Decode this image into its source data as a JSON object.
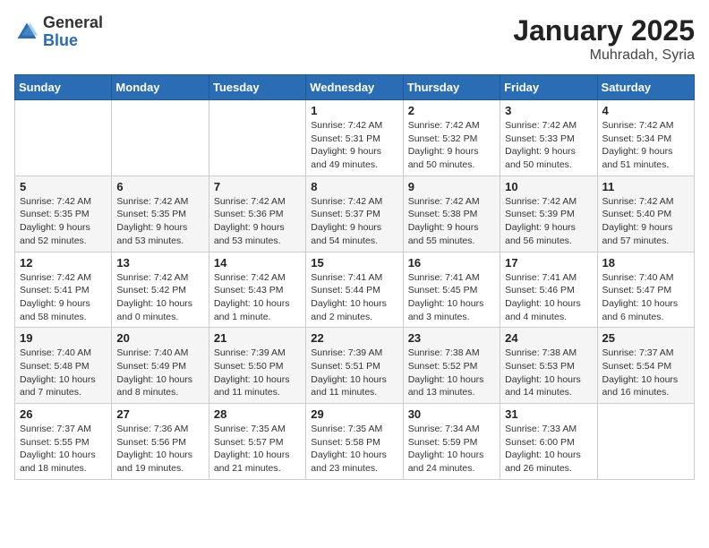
{
  "logo": {
    "general": "General",
    "blue": "Blue"
  },
  "header": {
    "month_year": "January 2025",
    "location": "Muhradah, Syria"
  },
  "weekdays": [
    "Sunday",
    "Monday",
    "Tuesday",
    "Wednesday",
    "Thursday",
    "Friday",
    "Saturday"
  ],
  "weeks": [
    [
      {
        "num": "",
        "info": ""
      },
      {
        "num": "",
        "info": ""
      },
      {
        "num": "",
        "info": ""
      },
      {
        "num": "1",
        "info": "Sunrise: 7:42 AM\nSunset: 5:31 PM\nDaylight: 9 hours\nand 49 minutes."
      },
      {
        "num": "2",
        "info": "Sunrise: 7:42 AM\nSunset: 5:32 PM\nDaylight: 9 hours\nand 50 minutes."
      },
      {
        "num": "3",
        "info": "Sunrise: 7:42 AM\nSunset: 5:33 PM\nDaylight: 9 hours\nand 50 minutes."
      },
      {
        "num": "4",
        "info": "Sunrise: 7:42 AM\nSunset: 5:34 PM\nDaylight: 9 hours\nand 51 minutes."
      }
    ],
    [
      {
        "num": "5",
        "info": "Sunrise: 7:42 AM\nSunset: 5:35 PM\nDaylight: 9 hours\nand 52 minutes."
      },
      {
        "num": "6",
        "info": "Sunrise: 7:42 AM\nSunset: 5:35 PM\nDaylight: 9 hours\nand 53 minutes."
      },
      {
        "num": "7",
        "info": "Sunrise: 7:42 AM\nSunset: 5:36 PM\nDaylight: 9 hours\nand 53 minutes."
      },
      {
        "num": "8",
        "info": "Sunrise: 7:42 AM\nSunset: 5:37 PM\nDaylight: 9 hours\nand 54 minutes."
      },
      {
        "num": "9",
        "info": "Sunrise: 7:42 AM\nSunset: 5:38 PM\nDaylight: 9 hours\nand 55 minutes."
      },
      {
        "num": "10",
        "info": "Sunrise: 7:42 AM\nSunset: 5:39 PM\nDaylight: 9 hours\nand 56 minutes."
      },
      {
        "num": "11",
        "info": "Sunrise: 7:42 AM\nSunset: 5:40 PM\nDaylight: 9 hours\nand 57 minutes."
      }
    ],
    [
      {
        "num": "12",
        "info": "Sunrise: 7:42 AM\nSunset: 5:41 PM\nDaylight: 9 hours\nand 58 minutes."
      },
      {
        "num": "13",
        "info": "Sunrise: 7:42 AM\nSunset: 5:42 PM\nDaylight: 10 hours\nand 0 minutes."
      },
      {
        "num": "14",
        "info": "Sunrise: 7:42 AM\nSunset: 5:43 PM\nDaylight: 10 hours\nand 1 minute."
      },
      {
        "num": "15",
        "info": "Sunrise: 7:41 AM\nSunset: 5:44 PM\nDaylight: 10 hours\nand 2 minutes."
      },
      {
        "num": "16",
        "info": "Sunrise: 7:41 AM\nSunset: 5:45 PM\nDaylight: 10 hours\nand 3 minutes."
      },
      {
        "num": "17",
        "info": "Sunrise: 7:41 AM\nSunset: 5:46 PM\nDaylight: 10 hours\nand 4 minutes."
      },
      {
        "num": "18",
        "info": "Sunrise: 7:40 AM\nSunset: 5:47 PM\nDaylight: 10 hours\nand 6 minutes."
      }
    ],
    [
      {
        "num": "19",
        "info": "Sunrise: 7:40 AM\nSunset: 5:48 PM\nDaylight: 10 hours\nand 7 minutes."
      },
      {
        "num": "20",
        "info": "Sunrise: 7:40 AM\nSunset: 5:49 PM\nDaylight: 10 hours\nand 8 minutes."
      },
      {
        "num": "21",
        "info": "Sunrise: 7:39 AM\nSunset: 5:50 PM\nDaylight: 10 hours\nand 11 minutes."
      },
      {
        "num": "22",
        "info": "Sunrise: 7:39 AM\nSunset: 5:51 PM\nDaylight: 10 hours\nand 11 minutes."
      },
      {
        "num": "23",
        "info": "Sunrise: 7:38 AM\nSunset: 5:52 PM\nDaylight: 10 hours\nand 13 minutes."
      },
      {
        "num": "24",
        "info": "Sunrise: 7:38 AM\nSunset: 5:53 PM\nDaylight: 10 hours\nand 14 minutes."
      },
      {
        "num": "25",
        "info": "Sunrise: 7:37 AM\nSunset: 5:54 PM\nDaylight: 10 hours\nand 16 minutes."
      }
    ],
    [
      {
        "num": "26",
        "info": "Sunrise: 7:37 AM\nSunset: 5:55 PM\nDaylight: 10 hours\nand 18 minutes."
      },
      {
        "num": "27",
        "info": "Sunrise: 7:36 AM\nSunset: 5:56 PM\nDaylight: 10 hours\nand 19 minutes."
      },
      {
        "num": "28",
        "info": "Sunrise: 7:35 AM\nSunset: 5:57 PM\nDaylight: 10 hours\nand 21 minutes."
      },
      {
        "num": "29",
        "info": "Sunrise: 7:35 AM\nSunset: 5:58 PM\nDaylight: 10 hours\nand 23 minutes."
      },
      {
        "num": "30",
        "info": "Sunrise: 7:34 AM\nSunset: 5:59 PM\nDaylight: 10 hours\nand 24 minutes."
      },
      {
        "num": "31",
        "info": "Sunrise: 7:33 AM\nSunset: 6:00 PM\nDaylight: 10 hours\nand 26 minutes."
      },
      {
        "num": "",
        "info": ""
      }
    ]
  ]
}
